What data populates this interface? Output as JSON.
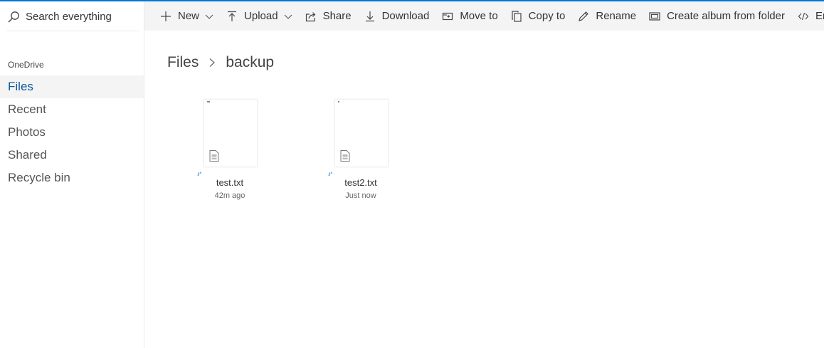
{
  "search": {
    "placeholder": "Search everything"
  },
  "sidebar": {
    "section_label": "OneDrive",
    "items": [
      {
        "label": "Files",
        "active": true
      },
      {
        "label": "Recent"
      },
      {
        "label": "Photos"
      },
      {
        "label": "Shared"
      },
      {
        "label": "Recycle bin"
      }
    ]
  },
  "commandbar": {
    "new": "New",
    "upload": "Upload",
    "share": "Share",
    "download": "Download",
    "move_to": "Move to",
    "copy_to": "Copy to",
    "rename": "Rename",
    "create_album": "Create album from folder",
    "embed": "Embed"
  },
  "breadcrumb": {
    "root": "Files",
    "current": "backup"
  },
  "files": [
    {
      "name": "test.txt",
      "modified": "42m ago"
    },
    {
      "name": "test2.txt",
      "modified": "Just now"
    }
  ],
  "colors": {
    "accent": "#0078d4",
    "active_text": "#0b5a9c",
    "toolbar_bg": "#f4f4f4"
  }
}
